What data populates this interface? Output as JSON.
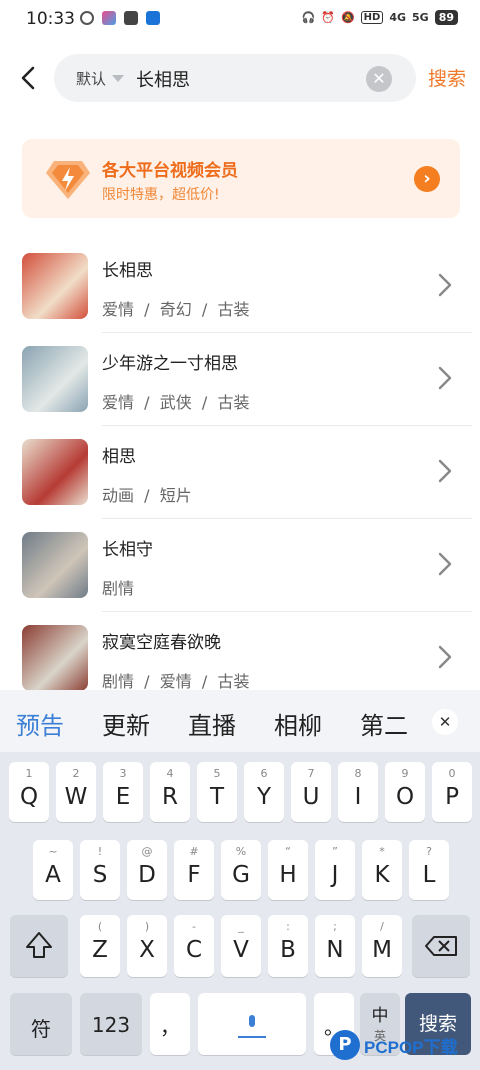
{
  "status_bar": {
    "time": "10:33",
    "battery": "89",
    "signal_1": "4G",
    "signal_2": "5G",
    "hd": "HD"
  },
  "search": {
    "scope": "默认",
    "query": "长相思",
    "submit_label": "搜索"
  },
  "promo": {
    "title": "各大平台视频会员",
    "subtitle": "限时特惠，超低价!"
  },
  "results": [
    {
      "title": "长相思",
      "tags": "爱情  /  奇幻  /  古装",
      "thumb_colors": [
        "#d24f3b",
        "#f1ddc8"
      ]
    },
    {
      "title": "少年游之一寸相思",
      "tags": "爱情  /  武侠  /  古装",
      "thumb_colors": [
        "#8aa3b2",
        "#e2e8e6"
      ]
    },
    {
      "title": "相思",
      "tags": "动画  /  短片",
      "thumb_colors": [
        "#e9dfcf",
        "#b63b35"
      ]
    },
    {
      "title": "长相守",
      "tags": "剧情",
      "thumb_colors": [
        "#6f7c88",
        "#cfc5b8"
      ]
    },
    {
      "title": "寂寞空庭春欲晚",
      "tags": "剧情  /  爱情  /  古装",
      "thumb_colors": [
        "#8c3d33",
        "#d9d4c9"
      ]
    }
  ],
  "keyboard": {
    "suggestions": [
      "预告",
      "更新",
      "直播",
      "相柳",
      "第二"
    ],
    "row1": [
      {
        "top": "1",
        "main": "Q"
      },
      {
        "top": "2",
        "main": "W"
      },
      {
        "top": "3",
        "main": "E"
      },
      {
        "top": "4",
        "main": "R"
      },
      {
        "top": "5",
        "main": "T"
      },
      {
        "top": "6",
        "main": "Y"
      },
      {
        "top": "7",
        "main": "U"
      },
      {
        "top": "8",
        "main": "I"
      },
      {
        "top": "9",
        "main": "O"
      },
      {
        "top": "0",
        "main": "P"
      }
    ],
    "row2": [
      {
        "top": "~",
        "main": "A"
      },
      {
        "top": "!",
        "main": "S"
      },
      {
        "top": "@",
        "main": "D"
      },
      {
        "top": "#",
        "main": "F"
      },
      {
        "top": "%",
        "main": "G"
      },
      {
        "top": "“",
        "main": "H"
      },
      {
        "top": "”",
        "main": "J"
      },
      {
        "top": "*",
        "main": "K"
      },
      {
        "top": "?",
        "main": "L"
      }
    ],
    "row3": [
      {
        "top": "(",
        "main": "Z"
      },
      {
        "top": ")",
        "main": "X"
      },
      {
        "top": "-",
        "main": "C"
      },
      {
        "top": "_",
        "main": "V"
      },
      {
        "top": ":",
        "main": "B"
      },
      {
        "top": ";",
        "main": "N"
      },
      {
        "top": "/",
        "main": "M"
      }
    ],
    "symbols_key": "符",
    "numbers_key": "123",
    "comma_key": "，",
    "lang_top": "中",
    "lang_bottom": "英",
    "submit_key": "搜索"
  },
  "watermark": {
    "logo": "P",
    "text": "PCPOP下载"
  },
  "colors": {
    "accent": "#f07a2a",
    "promo_bg": "#fff1e7",
    "suggest_active": "#3b7fd6",
    "submit_key": "#41587a"
  }
}
